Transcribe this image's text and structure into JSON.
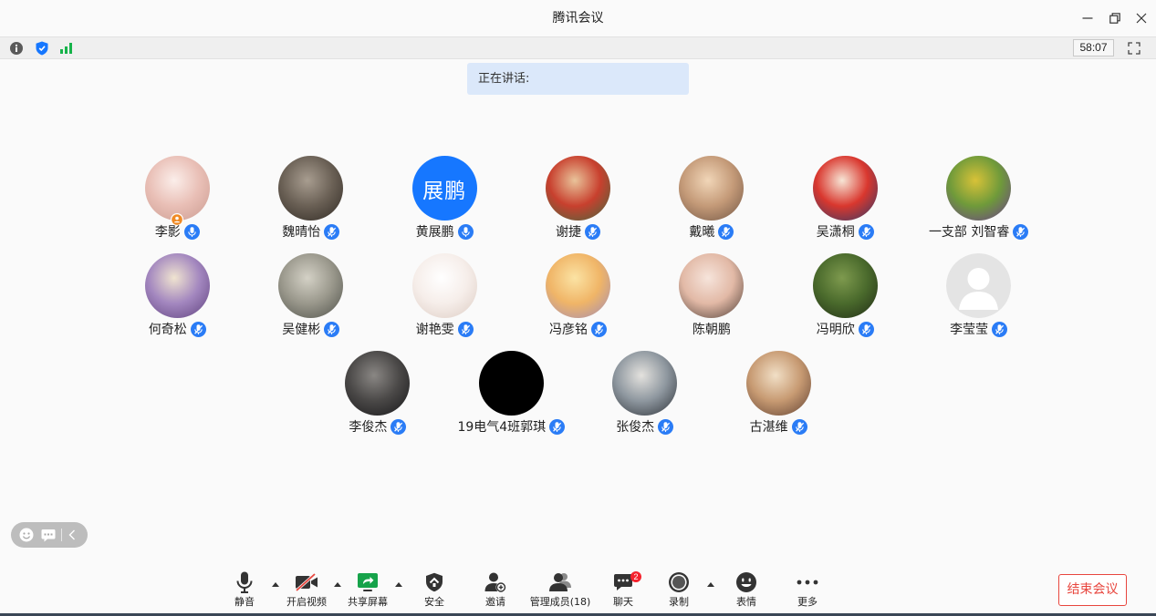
{
  "window": {
    "title": "腾讯会议",
    "controls": [
      "minimize-icon",
      "restore-icon",
      "close-icon"
    ]
  },
  "status_bar": {
    "icons": [
      "info-icon",
      "security-shield-icon",
      "network-signal-icon"
    ],
    "timer": "58:07",
    "fullscreen_icon": "fullscreen-icon"
  },
  "speaking": {
    "label": "正在讲话:"
  },
  "participants": [
    {
      "name": "李影",
      "mic_icon": "microphone-icon",
      "host_badge_icon": "host-icon",
      "avatar_colors": [
        "#fbeeea",
        "#e9bfb6",
        "#c99a8f"
      ]
    },
    {
      "name": "魏晴怡",
      "mic_icon": "microphone-muted-icon",
      "avatar_colors": [
        "#a89d90",
        "#6a6055",
        "#2f2923"
      ]
    },
    {
      "name": "黄展鹏",
      "mic_icon": "microphone-icon",
      "avatar_text": "展鹏",
      "avatar_colors": [
        "#1677ff"
      ]
    },
    {
      "name": "谢捷",
      "mic_icon": "microphone-muted-icon",
      "avatar_colors": [
        "#e9c39a",
        "#c8402e",
        "#3d6a3f"
      ]
    },
    {
      "name": "戴曦",
      "mic_icon": "microphone-muted-icon",
      "avatar_colors": [
        "#f1d6b8",
        "#c49a78",
        "#6f5443"
      ]
    },
    {
      "name": "吴潇桐",
      "mic_icon": "microphone-muted-icon",
      "avatar_colors": [
        "#f7e6d6",
        "#d9372e",
        "#273a6b"
      ]
    },
    {
      "name": "一支部 刘智睿",
      "mic_icon": "microphone-muted-icon",
      "avatar_colors": [
        "#d8c238",
        "#6f9a3a",
        "#6b3a8f"
      ]
    },
    {
      "name": "何奇松",
      "mic_icon": "microphone-muted-icon",
      "avatar_colors": [
        "#f0e4d0",
        "#a387bf",
        "#5d3f7c"
      ]
    },
    {
      "name": "吴健彬",
      "mic_icon": "microphone-muted-icon",
      "avatar_colors": [
        "#d4d1c6",
        "#9a988c",
        "#4d4f48"
      ]
    },
    {
      "name": "谢艳雯",
      "mic_icon": "microphone-muted-icon",
      "avatar_colors": [
        "#ffffff",
        "#f6eeea",
        "#dccbc2"
      ]
    },
    {
      "name": "冯彦铭",
      "mic_icon": "microphone-muted-icon",
      "avatar_colors": [
        "#fbe3a4",
        "#f0b567",
        "#9f8ab9"
      ]
    },
    {
      "name": "陈朝鹏",
      "avatar_colors": [
        "#f6e4db",
        "#e2b9a6",
        "#4a3a33"
      ]
    },
    {
      "name": "冯明欣",
      "mic_icon": "microphone-muted-icon",
      "avatar_colors": [
        "#7e9a4e",
        "#4a6a2c",
        "#1f2a15"
      ]
    },
    {
      "name": "李莹莹",
      "mic_icon": "microphone-muted-icon",
      "avatar_icon": "default-avatar-icon"
    },
    {
      "name": "李俊杰",
      "mic_icon": "microphone-muted-icon",
      "avatar_colors": [
        "#8a8784",
        "#4a4847",
        "#161618"
      ]
    },
    {
      "name": "19电气4班郭琪",
      "mic_icon": "microphone-muted-icon",
      "avatar_colors": [
        "#000000",
        "#000000"
      ]
    },
    {
      "name": "张俊杰",
      "mic_icon": "microphone-muted-icon",
      "avatar_colors": [
        "#e4e2de",
        "#8e979f",
        "#2b2f35"
      ]
    },
    {
      "name": "古湛维",
      "mic_icon": "microphone-muted-icon",
      "avatar_colors": [
        "#f1dfc6",
        "#c79a72",
        "#5e3f31"
      ]
    }
  ],
  "floating_tools": {
    "icons": [
      "emoji-icon",
      "chat-bubble-icon",
      "chevron-left-icon"
    ]
  },
  "toolbar": {
    "items": [
      {
        "label": "静音",
        "icon": "microphone-icon",
        "has_dropdown": true
      },
      {
        "label": "开启视频",
        "icon": "camera-off-icon",
        "has_dropdown": true
      },
      {
        "label": "共享屏幕",
        "icon": "share-screen-icon",
        "has_dropdown": true
      },
      {
        "label": "安全",
        "icon": "shield-icon"
      },
      {
        "label": "邀请",
        "icon": "invite-user-icon"
      },
      {
        "label": "管理成员(18)",
        "icon": "members-icon"
      },
      {
        "label": "聊天",
        "icon": "chat-icon",
        "badge": "2"
      },
      {
        "label": "录制",
        "icon": "record-icon",
        "has_dropdown": true
      },
      {
        "label": "表情",
        "icon": "emoji-icon"
      },
      {
        "label": "更多",
        "icon": "more-icon"
      }
    ],
    "end_meeting_label": "结束会议"
  },
  "colors": {
    "accent": "#2a7cf6",
    "end_meeting": "#e8463e",
    "host_badge": "#f08a24",
    "speaking_bg": "#dbe8fa"
  }
}
